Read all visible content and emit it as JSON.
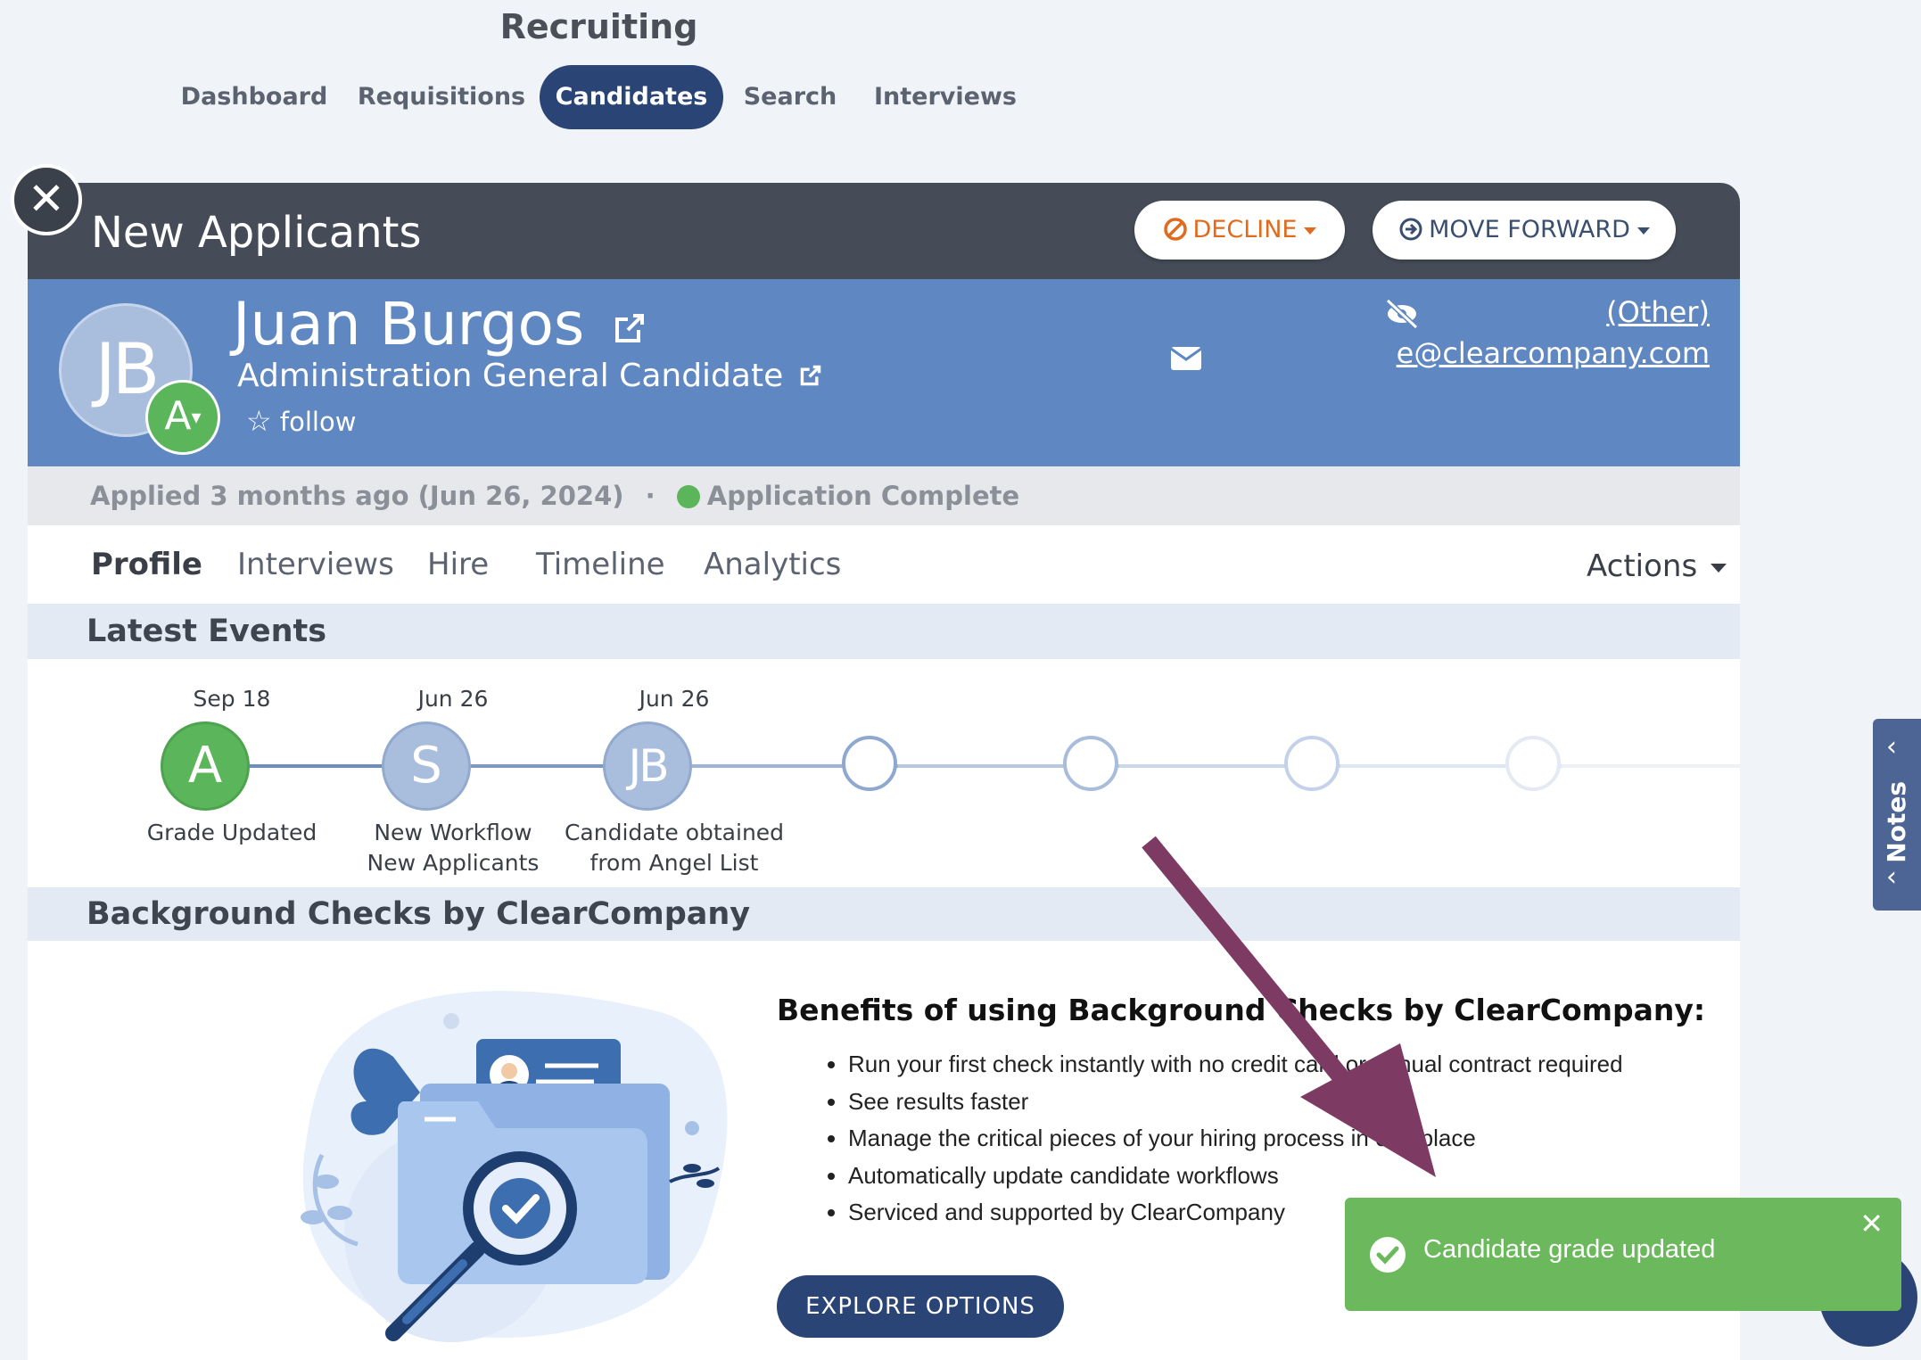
{
  "app": {
    "title": "Recruiting"
  },
  "nav": {
    "tabs": [
      {
        "label": "Dashboard"
      },
      {
        "label": "Requisitions"
      },
      {
        "label": "Candidates",
        "active": true
      },
      {
        "label": "Search"
      },
      {
        "label": "Interviews"
      }
    ]
  },
  "panel": {
    "title": "New Applicants",
    "decline_label": "DECLINE",
    "move_forward_label": "MOVE FORWARD"
  },
  "candidate": {
    "initials": "JB",
    "grade": "A",
    "name": "Juan Burgos",
    "role": "Administration General Candidate",
    "follow_label": "follow",
    "phone_type": "(Other)",
    "email_partial": "e@clearcompany.com"
  },
  "status": {
    "applied": "Applied 3 months ago (Jun 26, 2024)",
    "separator": "·",
    "application": "Application Complete"
  },
  "subtabs": [
    {
      "label": "Profile",
      "active": true
    },
    {
      "label": "Interviews"
    },
    {
      "label": "Hire"
    },
    {
      "label": "Timeline"
    },
    {
      "label": "Analytics"
    }
  ],
  "actions_label": "Actions",
  "latest_events": {
    "title": "Latest Events",
    "events": [
      {
        "date": "Sep 18",
        "initial": "A",
        "label": "Grade Updated",
        "label2": ""
      },
      {
        "date": "Jun 26",
        "initial": "S",
        "label": "New Workflow",
        "label2": "New Applicants"
      },
      {
        "date": "Jun 26",
        "initial": "JB",
        "label": "Candidate obtained",
        "label2": "from Angel List"
      }
    ]
  },
  "background_checks": {
    "title": "Background Checks by ClearCompany",
    "benefits_title": "Benefits of using Background Checks by ClearCompany:",
    "benefits": [
      "Run your first check instantly with no credit card or annual contract required",
      "See results faster",
      "Manage the critical pieces of your hiring process in one place",
      "Automatically update candidate workflows",
      "Serviced and supported by ClearCompany"
    ],
    "explore_label": "EXPLORE OPTIONS"
  },
  "toast": {
    "message": "Candidate grade updated"
  },
  "notes": {
    "label": "Notes"
  },
  "colors": {
    "nav_active": "#2a4475",
    "candidate_banner": "#5f87c1",
    "panel_header": "#454c57",
    "grade_green": "#5bb55b",
    "decline_orange": "#e06b1f",
    "toast_green": "#6cb85c",
    "arrow": "#7d3a63"
  }
}
